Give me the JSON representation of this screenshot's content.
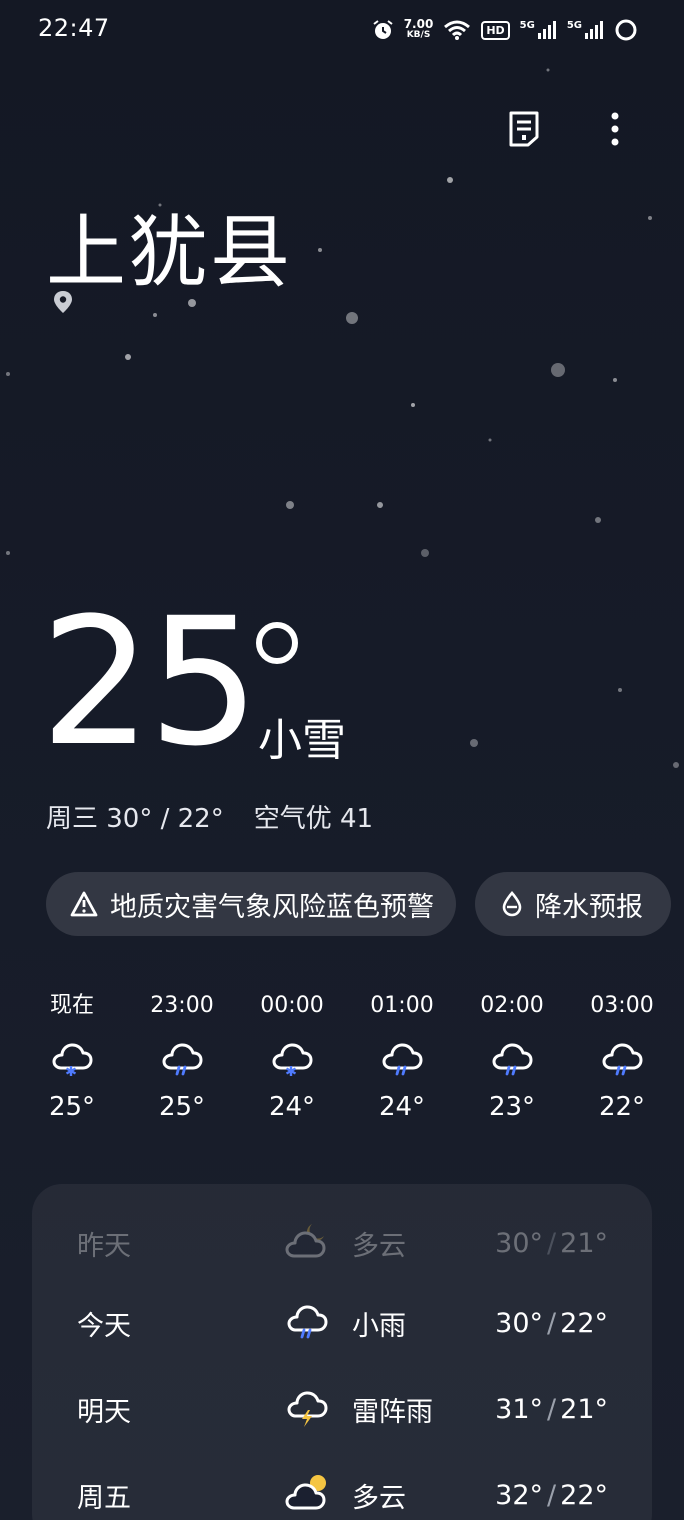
{
  "status_bar": {
    "time": "22:47",
    "net_speed_value": "7.00",
    "net_speed_unit": "KB/S",
    "hd_label": "HD",
    "sim1_label": "5G",
    "sim2_label": "5G"
  },
  "header": {
    "city": "上犹县"
  },
  "current": {
    "temperature": "25",
    "condition": "小雪",
    "day_range": "周三 30° / 22°",
    "air_quality": "空气优 41"
  },
  "alerts": {
    "warning_label": "地质灾害气象风险蓝色预警",
    "precip_label": "降水预报"
  },
  "hourly": [
    {
      "time": "现在",
      "temp": "25°",
      "icon": "snow-cloud-icon"
    },
    {
      "time": "23:00",
      "temp": "25°",
      "icon": "rain-cloud-icon"
    },
    {
      "time": "00:00",
      "temp": "24°",
      "icon": "snow-cloud-icon"
    },
    {
      "time": "01:00",
      "temp": "24°",
      "icon": "rain-cloud-icon"
    },
    {
      "time": "02:00",
      "temp": "23°",
      "icon": "rain-cloud-icon"
    },
    {
      "time": "03:00",
      "temp": "22°",
      "icon": "rain-cloud-icon"
    }
  ],
  "daily": [
    {
      "day": "昨天",
      "icon": "partly-cloudy-night-icon",
      "condition": "多云",
      "high": "30°",
      "low": "21°"
    },
    {
      "day": "今天",
      "icon": "rain-cloud-icon",
      "condition": "小雨",
      "high": "30°",
      "low": "22°"
    },
    {
      "day": "明天",
      "icon": "thunderstorm-icon",
      "condition": "雷阵雨",
      "high": "31°",
      "low": "21°"
    },
    {
      "day": "周五",
      "icon": "partly-cloudy-icon",
      "condition": "多云",
      "high": "32°",
      "low": "22°"
    }
  ],
  "colors": {
    "background": "#141824",
    "snow_accent": "#4f7bff",
    "rain_accent": "#4f7bff",
    "sun_accent": "#f5c542",
    "bolt_accent": "#f5c542"
  }
}
